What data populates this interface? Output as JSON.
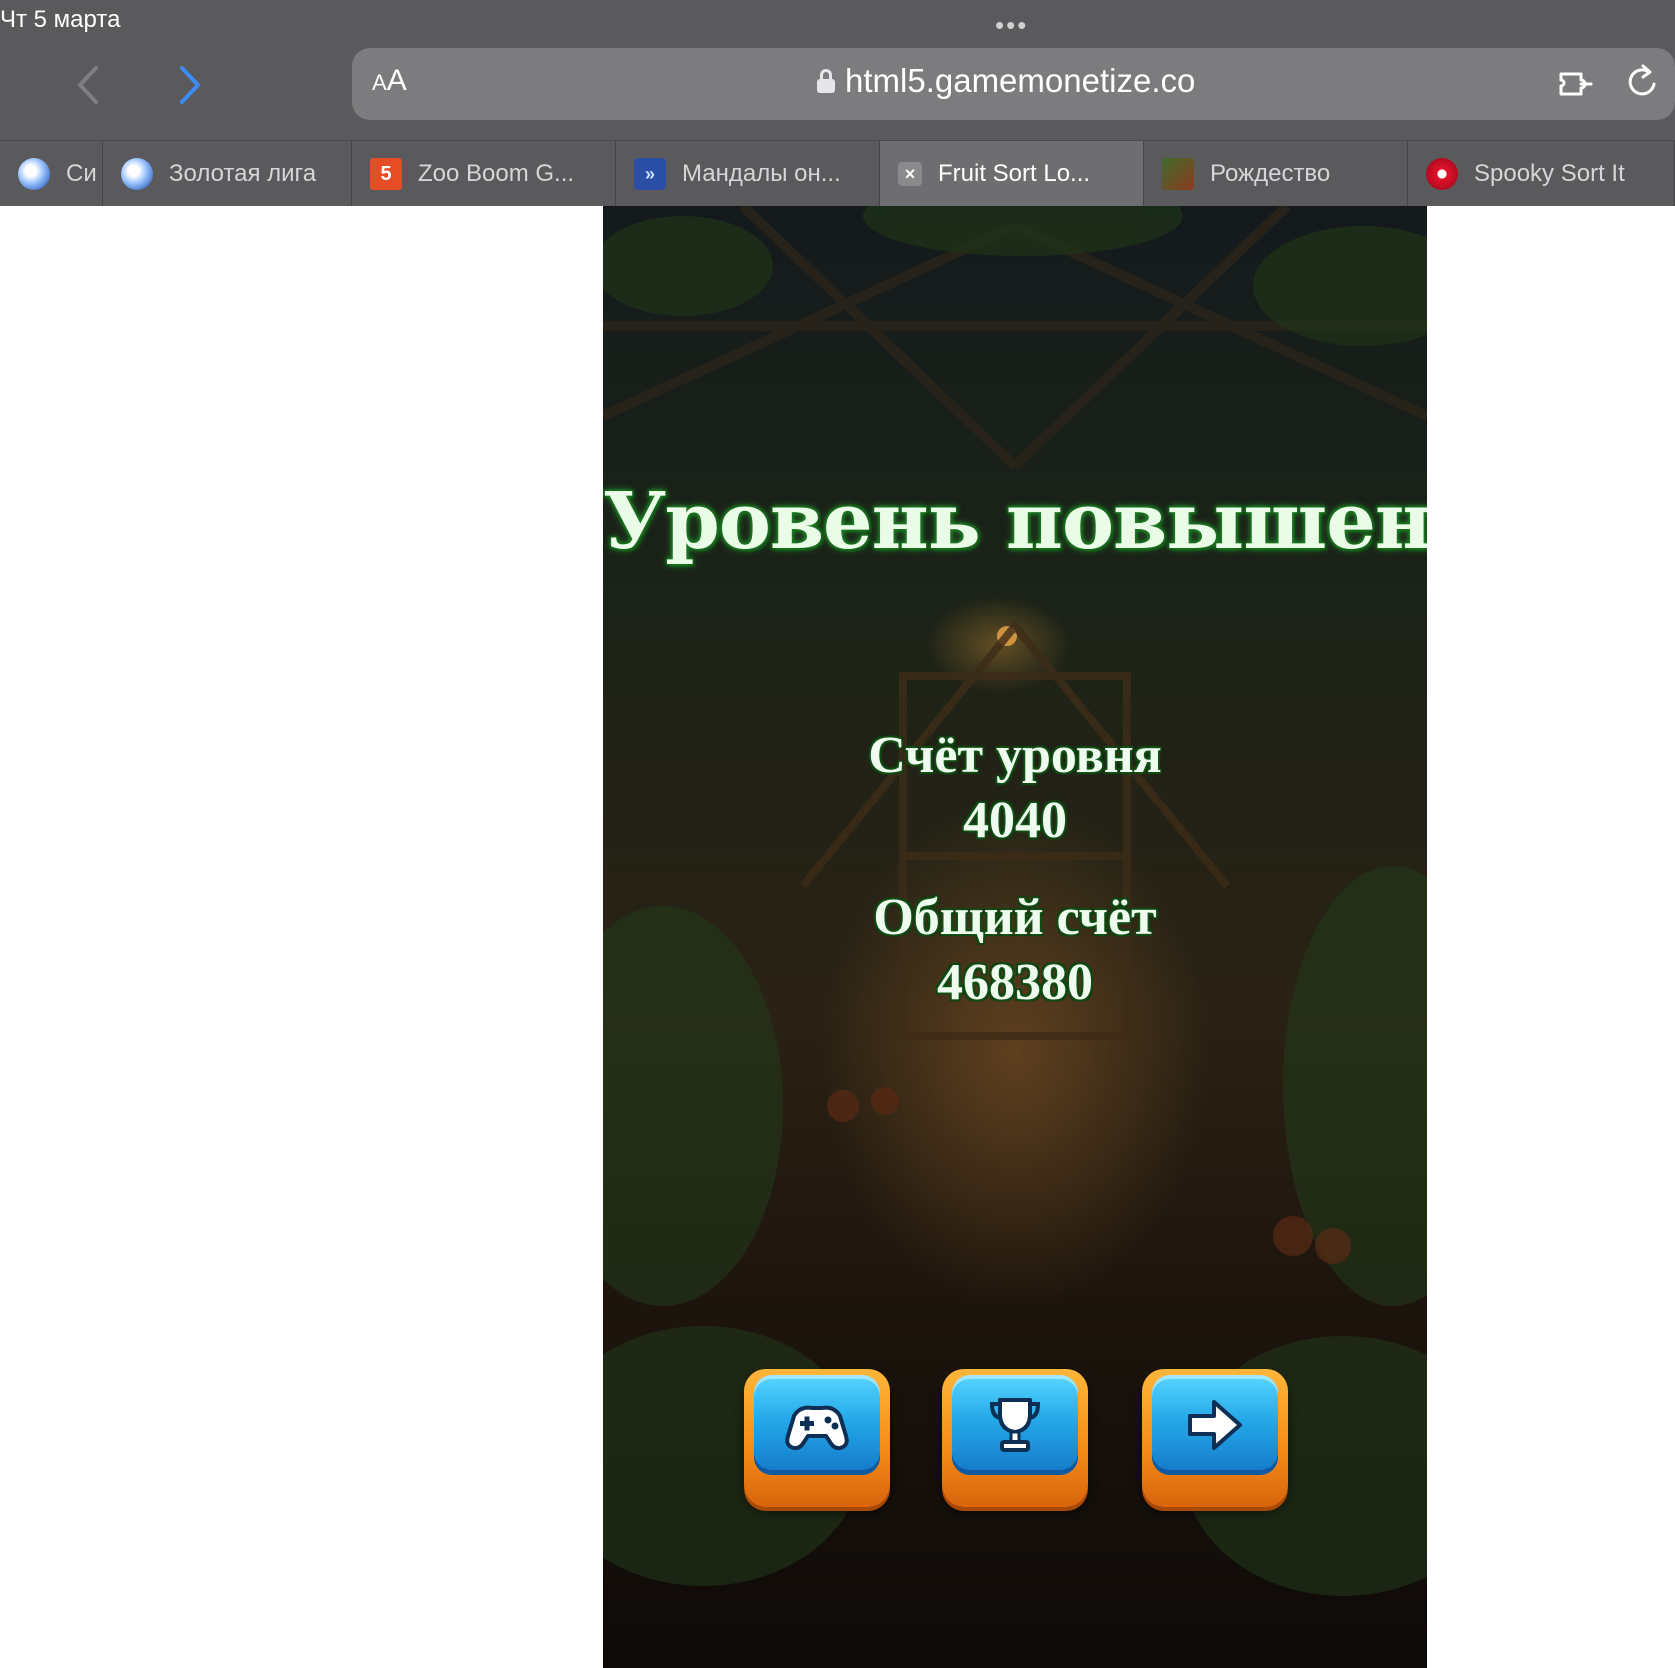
{
  "status": {
    "date": "Чт 5 марта",
    "dots": "•••"
  },
  "toolbar": {
    "text_size_label_small": "A",
    "text_size_label_large": "A",
    "url": "html5.gamemonetize.co"
  },
  "tabs": [
    {
      "label": "Си",
      "icon": "swirl-icon"
    },
    {
      "label": "Золотая лига",
      "icon": "swirl-icon"
    },
    {
      "label": "Zoo Boom G...",
      "icon": "html5-icon"
    },
    {
      "label": "Мандалы он...",
      "icon": "mandala-icon"
    },
    {
      "label": "Fruit Sort Lo...",
      "icon": "close-icon",
      "active": true
    },
    {
      "label": "Рождество",
      "icon": "christmas-icon"
    },
    {
      "label": "Spooky Sort It",
      "icon": "spooky-icon"
    }
  ],
  "game": {
    "title": "Уровень повышен",
    "level_score_label": "Счёт уровня",
    "level_score_value": "4040",
    "total_score_label": "Общий счёт",
    "total_score_value": "468380",
    "buttons": [
      {
        "name": "gamepad",
        "icon": "gamepad-icon"
      },
      {
        "name": "trophy",
        "icon": "trophy-icon"
      },
      {
        "name": "next",
        "icon": "arrow-right-icon"
      }
    ],
    "colors": {
      "title_glow": "#2da335",
      "button_frame": "#f48b16",
      "button_face": "#24a8e8"
    }
  }
}
